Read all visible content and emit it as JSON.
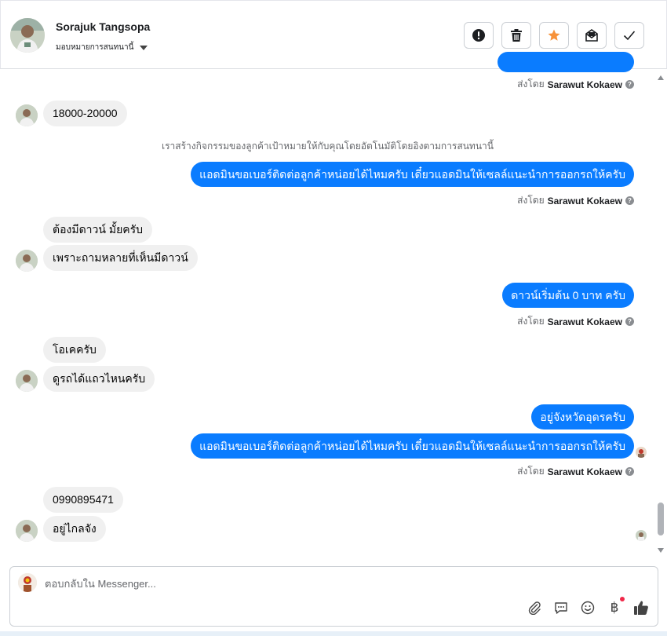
{
  "header": {
    "contact_name": "Sorajuk Tangsopa",
    "assign_label": "มอบหมายการสนทนานี้",
    "actions": [
      {
        "icon": "alert-icon",
        "name": "mark-spam-button"
      },
      {
        "icon": "trash-icon",
        "name": "delete-button"
      },
      {
        "icon": "star-icon",
        "name": "star-button"
      },
      {
        "icon": "mark-unread-icon",
        "name": "mark-unread-button"
      },
      {
        "icon": "check-icon",
        "name": "mark-done-button"
      }
    ]
  },
  "thread": {
    "sent_by_prefix": "ส่งโดย",
    "sent_by_agent": "Sarawut Kokaew",
    "messages": {
      "m1": "18000-20000",
      "system_note": "เราสร้างกิจกรรมของลูกค้าเป้าหมายให้กับคุณโดยอัตโนมัติโดยอิงตามการสนทนานี้",
      "m2": "แอดมินขอเบอร์ติดต่อลูกค้าหน่อยได้ไหมครับ เดี๋ยวแอดมินให้เซลล์แนะนำการออกรถให้ครับ",
      "m3": "ต้องมีดาวน์ มั้ยครับ",
      "m4": "เพราะถามหลายที่เห็นมีดาวน์",
      "m5": "ดาวน์เริ่มต้น 0 บาท ครับ",
      "m6": "โอเคครับ",
      "m7": "ดูรถได้แถวไหนครับ",
      "m8": "อยู่จังหวัดอุดรครับ",
      "m9": "แอดมินขอเบอร์ติดต่อลูกค้าหน่อยได้ไหมครับ เดี๋ยวแอดมินให้เซลล์แนะนำการออกรถให้ครับ",
      "m10": "0990895471",
      "m11": "อยู่ไกลจัง"
    }
  },
  "composer": {
    "placeholder": "ตอบกลับใน Messenger...",
    "tools": [
      "attach-icon",
      "saved-reply-icon",
      "emoji-icon",
      "baht-icon",
      "like-icon"
    ],
    "baht_symbol": "฿"
  },
  "colors": {
    "outgoing_bubble": "#0a7cff",
    "incoming_bubble": "#f0f0f0",
    "star": "#f7923a"
  }
}
